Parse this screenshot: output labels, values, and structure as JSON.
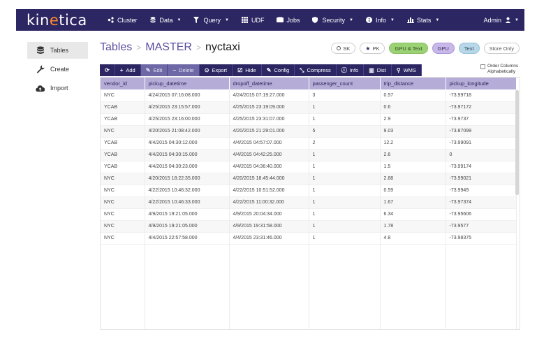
{
  "app": {
    "logo_pre": "kin",
    "logo_accent": "e",
    "logo_post": "tica",
    "user": "Admin"
  },
  "nav": [
    {
      "label": "Cluster",
      "icon": "cluster-icon",
      "caret": false
    },
    {
      "label": "Data",
      "icon": "database-icon",
      "caret": true
    },
    {
      "label": "Query",
      "icon": "filter-icon",
      "caret": true
    },
    {
      "label": "UDF",
      "icon": "grid-icon",
      "caret": false
    },
    {
      "label": "Jobs",
      "icon": "jobs-icon",
      "caret": false
    },
    {
      "label": "Security",
      "icon": "shield-icon",
      "caret": true
    },
    {
      "label": "Info",
      "icon": "info-icon",
      "caret": true
    },
    {
      "label": "Stats",
      "icon": "bar-chart-icon",
      "caret": true
    }
  ],
  "sidebar": {
    "items": [
      {
        "label": "Tables",
        "icon": "database-icon",
        "active": true
      },
      {
        "label": "Create",
        "icon": "wrench-icon",
        "active": false
      },
      {
        "label": "Import",
        "icon": "cloud-upload-icon",
        "active": false
      }
    ]
  },
  "breadcrumb": {
    "root": "Tables",
    "sep": ">",
    "schema": "MASTER",
    "table": "nyctaxi"
  },
  "badges": {
    "sk": "SK",
    "pk": "PK",
    "gpu_text": "GPU & Text",
    "gpu": "GPU",
    "text": "Text",
    "store_only": "Store Only"
  },
  "toolbar": {
    "add": "Add",
    "edit": "Edit",
    "delete": "Delete",
    "export": "Export",
    "hide": "Hide",
    "config": "Config",
    "compress": "Compress",
    "info": "Info",
    "dist": "Dist",
    "wms": "WMS"
  },
  "order_columns": {
    "line1": "Order Columns",
    "line2": "Alphabetically"
  },
  "table": {
    "columns": [
      "vendor_id",
      "pickup_datetime",
      "dropoff_datetime",
      "passenger_count",
      "trip_distance",
      "pickup_longitude"
    ],
    "rows": [
      [
        "NYC",
        "4/24/2015 07:16:08.000",
        "4/24/2015 07:19:27.000",
        "3",
        "0.57",
        "-73.99718"
      ],
      [
        "YCAB",
        "4/25/2015 23:15:57.000",
        "4/25/2015 23:19:09.000",
        "1",
        "0.6",
        "-73.97172"
      ],
      [
        "YCAB",
        "4/25/2015 23:16:00.000",
        "4/25/2015 23:31:07.000",
        "1",
        "2.9",
        "-73.9737"
      ],
      [
        "NYC",
        "4/20/2015 21:08:42.000",
        "4/20/2015 21:29:01.000",
        "5",
        "9.03",
        "-73.87099"
      ],
      [
        "YCAB",
        "4/4/2015 04:30:12.000",
        "4/4/2015 04:57:07.000",
        "2",
        "12.2",
        "-73.99091"
      ],
      [
        "YCAB",
        "4/4/2015 04:30:15.000",
        "4/4/2015 04:42:25.000",
        "1",
        "2.6",
        "0"
      ],
      [
        "YCAB",
        "4/4/2015 04:30:23.000",
        "4/4/2015 04:36:40.000",
        "1",
        "1.5",
        "-73.99174"
      ],
      [
        "NYC",
        "4/20/2015 18:22:35.000",
        "4/20/2015 18:45:44.000",
        "1",
        "2.88",
        "-73.99021"
      ],
      [
        "NYC",
        "4/22/2015 10:46:32.000",
        "4/22/2015 10:51:52.000",
        "1",
        "0.59",
        "-73.9949"
      ],
      [
        "NYC",
        "4/22/2015 10:46:33.000",
        "4/22/2015 11:00:32.000",
        "1",
        "1.67",
        "-73.97374"
      ],
      [
        "NYC",
        "4/9/2015 19:21:05.000",
        "4/9/2015 20:04:34.000",
        "1",
        "6.34",
        "-73.95606"
      ],
      [
        "NYC",
        "4/9/2015 19:21:05.000",
        "4/9/2015 19:31:58.000",
        "1",
        "1.78",
        "-73.9577"
      ],
      [
        "NYC",
        "4/4/2015 22:57:58.000",
        "4/4/2015 23:31:46.000",
        "1",
        "4.8",
        "-73.98375"
      ]
    ]
  },
  "colors": {
    "nav_bg": "#2c2663",
    "accent": "#ff8a2a",
    "header_bg": "#b5acd8",
    "link": "#5a4fa0"
  }
}
